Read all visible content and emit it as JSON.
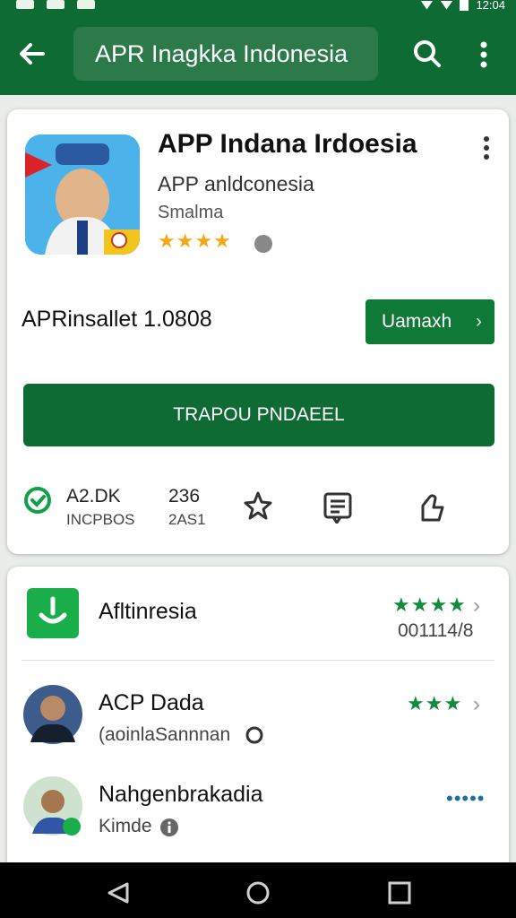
{
  "status_bar": {
    "time": "12:04"
  },
  "app_bar": {
    "search_text": "APR Inagkka Indonesia"
  },
  "app": {
    "title": "APP Indana Irdoesia",
    "subtitle": "APP anldconesia",
    "developer": "Smalma",
    "stars": "★★★★",
    "installer_text": "APRinsallet 1.0808",
    "small_button": "Uamaxh",
    "install_button": "TRAPOU PNDAEEL"
  },
  "stats": [
    {
      "line1": "A2.DK",
      "line2": "INCPBOS",
      "icon": "check-circle-icon"
    },
    {
      "line1": "236",
      "line2": "2AS1",
      "icon": "star-outline-icon"
    },
    {
      "icon": "document-icon"
    },
    {
      "icon": "thumbs-up-icon"
    }
  ],
  "list": [
    {
      "title": "Afltinresia",
      "subtitle": "001114/8",
      "stars": "★★★★",
      "icon": "green-app-icon"
    },
    {
      "title": "ACP Dada",
      "subtitle": "(aoinlaSannnan",
      "stars": "★★★",
      "icon": "avatar"
    },
    {
      "title": "Nahgenbrakadia",
      "subtitle": "Kimde",
      "stars": "•••••",
      "icon": "avatar"
    }
  ],
  "colors": {
    "brand": "#0f6b34",
    "accent": "#0f7a38",
    "star": "#f3a817",
    "green_star": "#118a3c"
  }
}
